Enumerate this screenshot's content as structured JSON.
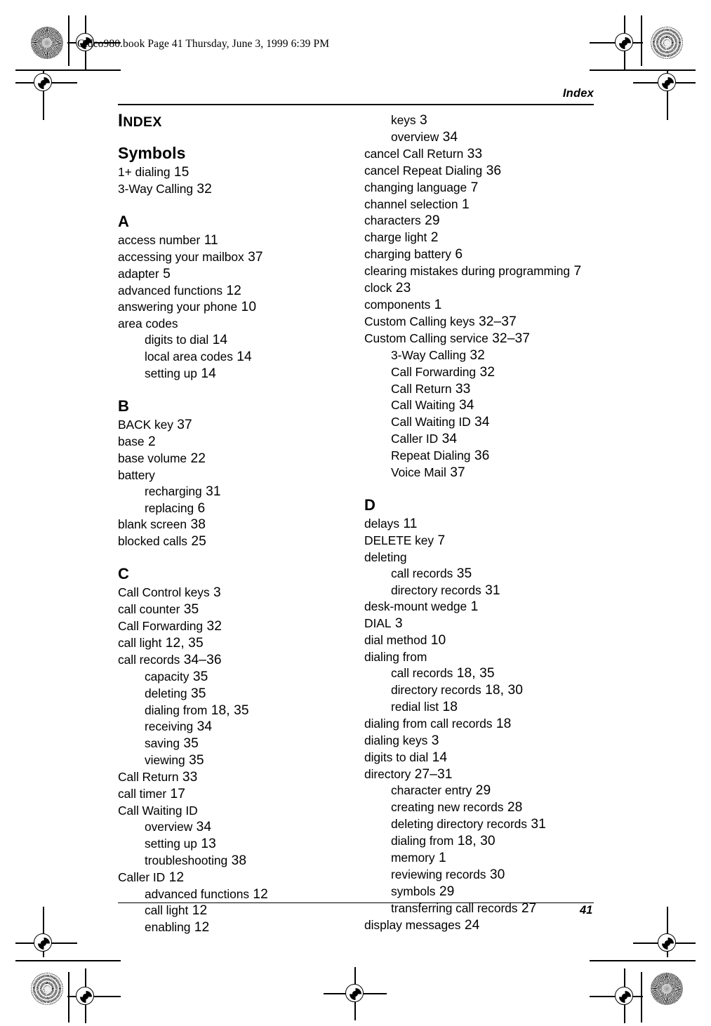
{
  "slug": "Cidco980.book  Page 41  Thursday, June 3, 1999  6:39 PM",
  "running_head": "Index",
  "folio": "41",
  "index": {
    "title_cap": "I",
    "title_rest": "NDEX",
    "columns": [
      {
        "name": "left-column",
        "blocks": [
          {
            "heading": "Symbols",
            "entries": [
              {
                "text": "1+ dialing",
                "page": "15",
                "level": 0
              },
              {
                "text": "3-Way Calling",
                "page": "32",
                "level": 0
              }
            ]
          },
          {
            "heading": "A",
            "entries": [
              {
                "text": "access number",
                "page": "11",
                "level": 0
              },
              {
                "text": "accessing your mailbox",
                "page": "37",
                "level": 0
              },
              {
                "text": "adapter",
                "page": "5",
                "level": 0
              },
              {
                "text": "advanced functions",
                "page": "12",
                "level": 0
              },
              {
                "text": "answering your phone",
                "page": "10",
                "level": 0
              },
              {
                "text": "area codes",
                "page": "",
                "level": 0
              },
              {
                "text": "digits to dial",
                "page": "14",
                "level": 1
              },
              {
                "text": "local area codes",
                "page": "14",
                "level": 1
              },
              {
                "text": "setting up",
                "page": "14",
                "level": 1
              }
            ]
          },
          {
            "heading": "B",
            "entries": [
              {
                "text": "BACK key",
                "page": "37",
                "level": 0
              },
              {
                "text": "base",
                "page": "2",
                "level": 0
              },
              {
                "text": "base volume",
                "page": "22",
                "level": 0
              },
              {
                "text": "battery",
                "page": "",
                "level": 0
              },
              {
                "text": "recharging",
                "page": "31",
                "level": 1
              },
              {
                "text": "replacing",
                "page": "6",
                "level": 1
              },
              {
                "text": "blank screen",
                "page": "38",
                "level": 0
              },
              {
                "text": "blocked calls",
                "page": "25",
                "level": 0
              }
            ]
          },
          {
            "heading": "C",
            "entries": [
              {
                "text": "Call Control keys",
                "page": "3",
                "level": 0
              },
              {
                "text": "call counter",
                "page": "35",
                "level": 0
              },
              {
                "text": "Call Forwarding",
                "page": "32",
                "level": 0
              },
              {
                "text": "call light",
                "page": "12, 35",
                "level": 0
              },
              {
                "text": "call records",
                "page": "34–36",
                "level": 0
              },
              {
                "text": "capacity",
                "page": "35",
                "level": 1
              },
              {
                "text": "deleting",
                "page": "35",
                "level": 1
              },
              {
                "text": "dialing from",
                "page": "18, 35",
                "level": 1
              },
              {
                "text": "receiving",
                "page": "34",
                "level": 1
              },
              {
                "text": "saving",
                "page": "35",
                "level": 1
              },
              {
                "text": "viewing",
                "page": "35",
                "level": 1
              },
              {
                "text": "Call Return",
                "page": "33",
                "level": 0
              },
              {
                "text": "call timer",
                "page": "17",
                "level": 0
              },
              {
                "text": "Call Waiting ID",
                "page": "",
                "level": 0
              },
              {
                "text": "overview",
                "page": "34",
                "level": 1
              },
              {
                "text": "setting up",
                "page": "13",
                "level": 1
              },
              {
                "text": "troubleshooting",
                "page": "38",
                "level": 1
              },
              {
                "text": "Caller ID",
                "page": "12",
                "level": 0
              },
              {
                "text": "advanced functions",
                "page": "12",
                "level": 1
              },
              {
                "text": "call light",
                "page": "12",
                "level": 1
              },
              {
                "text": "enabling",
                "page": "12",
                "level": 1
              }
            ]
          }
        ]
      },
      {
        "name": "right-column",
        "blocks": [
          {
            "heading": "",
            "entries": [
              {
                "text": "keys",
                "page": "3",
                "level": 1
              },
              {
                "text": "overview",
                "page": "34",
                "level": 1
              },
              {
                "text": "cancel Call Return",
                "page": "33",
                "level": 0
              },
              {
                "text": "cancel Repeat Dialing",
                "page": "36",
                "level": 0
              },
              {
                "text": "changing language",
                "page": "7",
                "level": 0
              },
              {
                "text": "channel selection",
                "page": "1",
                "level": 0
              },
              {
                "text": "characters",
                "page": "29",
                "level": 0
              },
              {
                "text": "charge light",
                "page": "2",
                "level": 0
              },
              {
                "text": "charging battery",
                "page": "6",
                "level": 0
              },
              {
                "text": "clearing mistakes during programming",
                "page": "7",
                "level": 0
              },
              {
                "text": "clock",
                "page": "23",
                "level": 0
              },
              {
                "text": "components",
                "page": "1",
                "level": 0
              },
              {
                "text": "Custom Calling keys",
                "page": "32–37",
                "level": 0
              },
              {
                "text": "Custom Calling service",
                "page": "32–37",
                "level": 0
              },
              {
                "text": "3-Way Calling",
                "page": "32",
                "level": 1
              },
              {
                "text": "Call Forwarding",
                "page": "32",
                "level": 1
              },
              {
                "text": "Call Return",
                "page": "33",
                "level": 1
              },
              {
                "text": "Call Waiting",
                "page": "34",
                "level": 1
              },
              {
                "text": "Call Waiting ID",
                "page": "34",
                "level": 1
              },
              {
                "text": "Caller ID",
                "page": "34",
                "level": 1
              },
              {
                "text": "Repeat Dialing",
                "page": "36",
                "level": 1
              },
              {
                "text": "Voice Mail",
                "page": "37",
                "level": 1
              }
            ]
          },
          {
            "heading": "D",
            "entries": [
              {
                "text": "delays",
                "page": "11",
                "level": 0
              },
              {
                "text": "DELETE key",
                "page": "7",
                "level": 0
              },
              {
                "text": "deleting",
                "page": "",
                "level": 0
              },
              {
                "text": "call records",
                "page": "35",
                "level": 1
              },
              {
                "text": "directory records",
                "page": "31",
                "level": 1
              },
              {
                "text": "desk-mount wedge",
                "page": "1",
                "level": 0
              },
              {
                "text": "DIAL",
                "page": "3",
                "level": 0
              },
              {
                "text": "dial method",
                "page": "10",
                "level": 0
              },
              {
                "text": "dialing from",
                "page": "",
                "level": 0
              },
              {
                "text": "call records",
                "page": "18, 35",
                "level": 1
              },
              {
                "text": "directory records",
                "page": "18, 30",
                "level": 1
              },
              {
                "text": "redial list",
                "page": "18",
                "level": 1
              },
              {
                "text": "dialing from call records",
                "page": "18",
                "level": 0
              },
              {
                "text": "dialing keys",
                "page": "3",
                "level": 0
              },
              {
                "text": "digits to dial",
                "page": "14",
                "level": 0
              },
              {
                "text": "directory",
                "page": "27–31",
                "level": 0
              },
              {
                "text": "character entry",
                "page": "29",
                "level": 1
              },
              {
                "text": "creating new records",
                "page": "28",
                "level": 1
              },
              {
                "text": "deleting directory records",
                "page": "31",
                "level": 1
              },
              {
                "text": "dialing from",
                "page": "18, 30",
                "level": 1
              },
              {
                "text": "memory",
                "page": "1",
                "level": 1
              },
              {
                "text": "reviewing records",
                "page": "30",
                "level": 1
              },
              {
                "text": "symbols",
                "page": "29",
                "level": 1
              },
              {
                "text": "transferring call records",
                "page": "27",
                "level": 1
              },
              {
                "text": "display messages",
                "page": "24",
                "level": 0
              }
            ]
          }
        ]
      }
    ]
  }
}
